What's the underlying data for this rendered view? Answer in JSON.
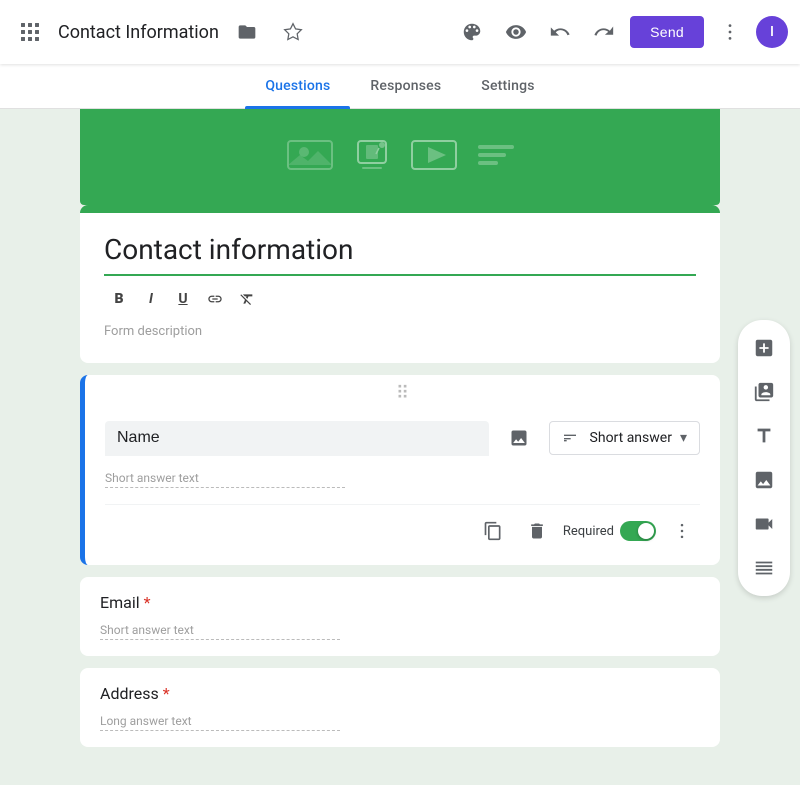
{
  "topbar": {
    "app_name": "Contact Information",
    "send_label": "Send",
    "avatar_letter": "I"
  },
  "tabs": {
    "items": [
      {
        "id": "questions",
        "label": "Questions",
        "active": true
      },
      {
        "id": "responses",
        "label": "Responses",
        "active": false
      },
      {
        "id": "settings",
        "label": "Settings",
        "active": false
      }
    ]
  },
  "form": {
    "title": "Contact information",
    "description": "Form description"
  },
  "questions": [
    {
      "id": "name",
      "label": "Name",
      "type": "Short answer",
      "placeholder": "Short answer text",
      "required": true,
      "active": true
    },
    {
      "id": "email",
      "label": "Email",
      "type": "Short answer",
      "placeholder": "Short answer text",
      "required": true,
      "active": false
    },
    {
      "id": "address",
      "label": "Address",
      "type": "Long answer",
      "placeholder": "Long answer text",
      "required": true,
      "active": false
    }
  ],
  "formatting": {
    "bold": "B",
    "italic": "I",
    "underline": "U",
    "link": "🔗",
    "clear": "✕"
  },
  "right_toolbar": {
    "add_label": "add",
    "copy_label": "copy-section",
    "title_label": "title-text",
    "image_label": "add-image",
    "video_label": "add-video",
    "section_label": "add-section"
  },
  "colors": {
    "green": "#34a853",
    "blue": "#1a73e8",
    "purple": "#6741d9",
    "required_red": "#d93025"
  }
}
